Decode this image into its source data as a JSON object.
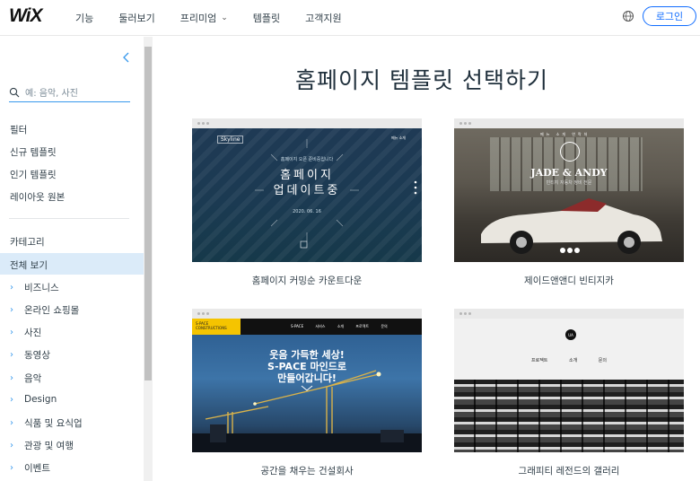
{
  "header": {
    "logo": "WiX",
    "nav": [
      {
        "label": "기능",
        "has_dropdown": false
      },
      {
        "label": "둘러보기",
        "has_dropdown": false
      },
      {
        "label": "프리미엄",
        "has_dropdown": true
      },
      {
        "label": "템플릿",
        "has_dropdown": false
      },
      {
        "label": "고객지원",
        "has_dropdown": false
      }
    ],
    "globe_icon": "globe-icon",
    "login_label": "로그인"
  },
  "sidebar": {
    "search_placeholder": "예: 음악, 사진",
    "filter_heading": "필터",
    "filters": [
      "신규 템플릿",
      "인기 템플릿",
      "레이아웃 원본"
    ],
    "category_heading": "카테고리",
    "all_label": "전체 보기",
    "categories": [
      "비즈니스",
      "온라인 쇼핑몰",
      "사진",
      "동영상",
      "음악",
      "Design",
      "식품 및 요식업",
      "관광 및 여행",
      "이벤트"
    ]
  },
  "main": {
    "title": "홈페이지 템플릿 선택하기",
    "templates": [
      {
        "caption": "홈페이지 커밍순 카운트다운",
        "thumb": {
          "logo": "Skyline",
          "nav": "메뉴   소개",
          "small": "홈페이지 오픈 준비중입니다",
          "line1": "홈페이지",
          "line2": "업데이트중",
          "date": "2020. 06. 16"
        }
      },
      {
        "caption": "제이드앤앤디 빈티지카",
        "thumb": {
          "brand": "JADE & ANDY",
          "sub": "빈티지 자동차 정비 전문",
          "nav": "메뉴 소개 연락처"
        }
      },
      {
        "caption": "공간을 채우는 건설회사",
        "thumb": {
          "tag": "S-PACE CONSTRUCTIONS",
          "menu": "S-PACE 서비스 소개 프로젝트 문의",
          "headline1": "웃음 가득한 세상!",
          "headline2": "S-PACE 마인드로",
          "headline3": "만들어갑니다!"
        }
      },
      {
        "caption": "그래피티 레전드의 갤러리",
        "thumb": {
          "badge": "UA",
          "menu": "프로젝트 소개 문의"
        }
      }
    ]
  },
  "colors": {
    "accent": "#116dff",
    "sidebar_active": "#dbebf9",
    "search_line": "#3899ec"
  }
}
